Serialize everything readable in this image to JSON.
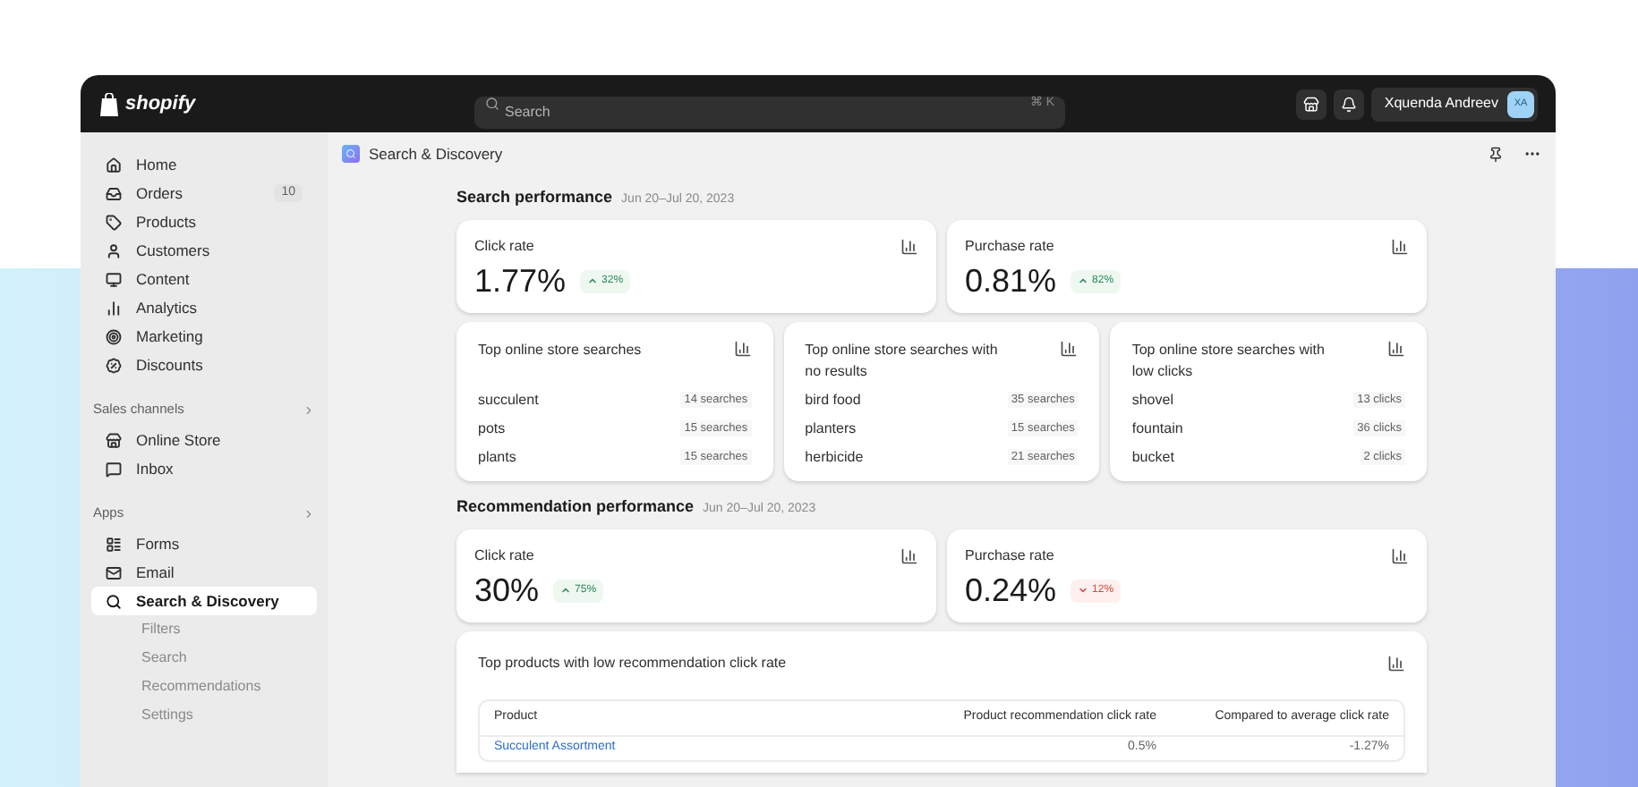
{
  "topbar": {
    "logo": "shopify",
    "search": {
      "placeholder": "Search",
      "shortcut": "⌘ K"
    },
    "user": {
      "name": "Xquenda Andreev",
      "initials": "XA"
    }
  },
  "sidebar": {
    "items": [
      {
        "label": "Home",
        "selected": false
      },
      {
        "label": "Orders",
        "badge": "10",
        "selected": false
      },
      {
        "label": "Products",
        "selected": false
      },
      {
        "label": "Customers",
        "selected": false
      },
      {
        "label": "Content",
        "selected": false
      },
      {
        "label": "Analytics",
        "selected": false
      },
      {
        "label": "Marketing",
        "selected": false
      },
      {
        "label": "Discounts",
        "selected": false
      }
    ],
    "sections": [
      {
        "title": "Sales channels",
        "items": [
          {
            "label": "Online Store",
            "selected": false
          },
          {
            "label": "Inbox",
            "selected": false
          }
        ]
      },
      {
        "title": "Apps",
        "items": [
          {
            "label": "Forms",
            "selected": false
          },
          {
            "label": "Email",
            "selected": false
          },
          {
            "label": "Search & Discovery",
            "selected": true,
            "children": [
              {
                "label": "Filters"
              },
              {
                "label": "Search"
              },
              {
                "label": "Recommendations"
              },
              {
                "label": "Settings"
              }
            ]
          }
        ]
      }
    ]
  },
  "page": {
    "title": "Search & Discovery",
    "sections": [
      {
        "title": "Search performance",
        "date": "Jun 20–Jul 20, 2023",
        "metrics": [
          {
            "label": "Click rate",
            "value": "1.77%",
            "change": "32%",
            "kind": "rise"
          },
          {
            "label": "Purchase rate",
            "value": "0.81%",
            "change": "82%",
            "kind": "rise"
          }
        ],
        "lists": [
          {
            "title": "Top online store searches",
            "rows": [
              {
                "term": "succulent",
                "count": "14 searches"
              },
              {
                "term": "pots",
                "count": "15 searches"
              },
              {
                "term": "plants",
                "count": "15 searches"
              }
            ]
          },
          {
            "title": "Top online store searches with no results",
            "rows": [
              {
                "term": "bird food",
                "count": "35 searches"
              },
              {
                "term": "planters",
                "count": "15 searches"
              },
              {
                "term": "herbicide",
                "count": "21 searches"
              }
            ]
          },
          {
            "title": "Top online store searches with low clicks",
            "rows": [
              {
                "term": "shovel",
                "count": "13 clicks"
              },
              {
                "term": "fountain",
                "count": "36 clicks"
              },
              {
                "term": "bucket",
                "count": "2 clicks"
              }
            ]
          }
        ]
      },
      {
        "title": "Recommendation performance",
        "date": "Jun 20–Jul 20, 2023",
        "metrics": [
          {
            "label": "Click rate",
            "value": "30%",
            "change": "75%",
            "kind": "rise"
          },
          {
            "label": "Purchase rate",
            "value": "0.24%",
            "change": "12%",
            "kind": "fall"
          }
        ],
        "table": {
          "title": "Top products with low recommendation click rate",
          "columns": [
            "Product",
            "Product recommendation click rate",
            "Compared to average click rate"
          ],
          "rows": [
            [
              "Succulent Assortment",
              "0.5%",
              "-1.27%"
            ]
          ]
        }
      }
    ]
  }
}
